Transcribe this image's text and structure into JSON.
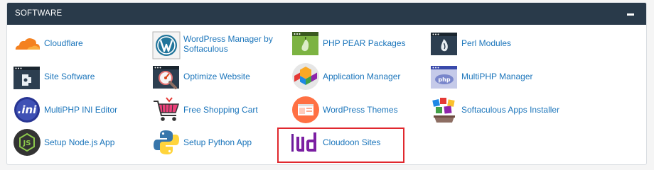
{
  "panel": {
    "title": "SOFTWARE",
    "collapse_label": "collapse"
  },
  "items": [
    {
      "label": "Cloudflare",
      "icon": "cloudflare-icon"
    },
    {
      "label": "WordPress Manager by Softaculous",
      "label_line1": "WordPress Manager by",
      "label_line2": "Softaculous",
      "icon": "wordpress-icon"
    },
    {
      "label": "PHP PEAR Packages",
      "icon": "php-pear-icon"
    },
    {
      "label": "Perl Modules",
      "icon": "perl-icon"
    },
    {
      "label": "Site Software",
      "icon": "site-software-icon"
    },
    {
      "label": "Optimize Website",
      "icon": "optimize-website-icon"
    },
    {
      "label": "Application Manager",
      "icon": "application-manager-icon"
    },
    {
      "label": "MultiPHP Manager",
      "icon": "multiphp-manager-icon"
    },
    {
      "label": "MultiPHP INI Editor",
      "icon": "multiphp-ini-icon"
    },
    {
      "label": "Free Shopping Cart",
      "icon": "shopping-cart-icon"
    },
    {
      "label": "WordPress Themes",
      "icon": "wordpress-themes-icon"
    },
    {
      "label": "Softaculous Apps Installer",
      "icon": "softaculous-icon"
    },
    {
      "label": "Setup Node.js App",
      "icon": "nodejs-icon"
    },
    {
      "label": "Setup Python App",
      "icon": "python-icon"
    },
    {
      "label": "Cloudoon Sites",
      "icon": "cloudoon-icon"
    }
  ],
  "colors": {
    "header_bg": "#293a4a",
    "link": "#1b75bb",
    "highlight": "#e0282e"
  }
}
